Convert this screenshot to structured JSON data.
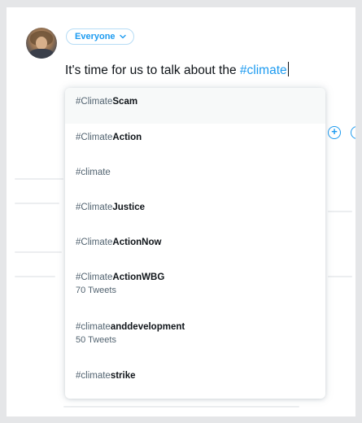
{
  "composer": {
    "audience_label": "Everyone",
    "text_before": "It's time for us to talk about the ",
    "hashtag": "#climate"
  },
  "suggestions": [
    {
      "match": "#Climate",
      "rest": "Scam",
      "count": "",
      "highlighted": true
    },
    {
      "match": "#Climate",
      "rest": "Action",
      "count": ""
    },
    {
      "match": "#climate",
      "rest": "",
      "count": ""
    },
    {
      "match": "#Climate",
      "rest": "Justice",
      "count": ""
    },
    {
      "match": "#Climate",
      "rest": "ActionNow",
      "count": ""
    },
    {
      "match": "#Climate",
      "rest": "ActionWBG",
      "count": "70 Tweets"
    },
    {
      "match": "#climate",
      "rest": "anddevelopment",
      "count": "50 Tweets"
    },
    {
      "match": "#climate",
      "rest": "strike",
      "count": ""
    }
  ],
  "colors": {
    "accent": "#1d9bf0",
    "text": "#0f1419",
    "muted": "#536471"
  },
  "icons": {
    "chevron": "chevron-down-icon",
    "add": "plus-circle-icon"
  }
}
